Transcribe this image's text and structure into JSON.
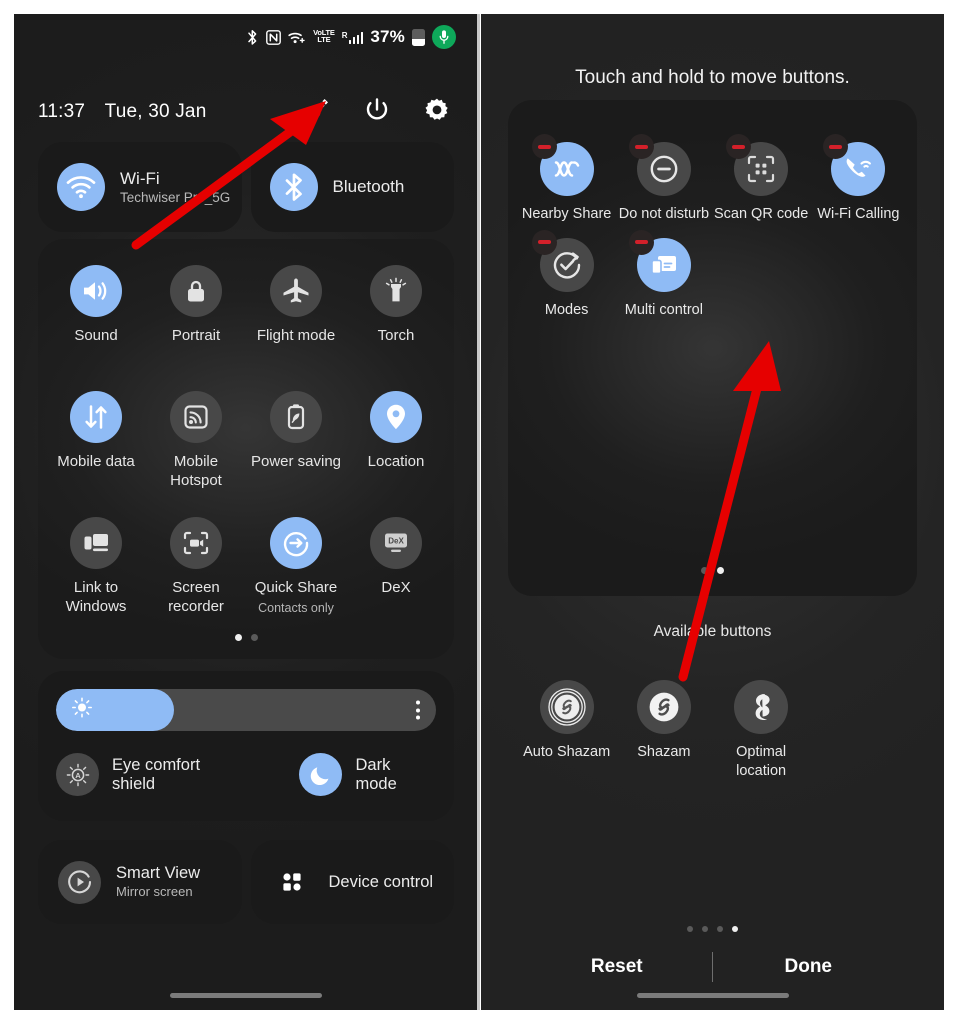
{
  "colors": {
    "accent_blue": "#8FBBF5",
    "tile_off": "#484848",
    "panel_bg": "#1c1c1c",
    "card_bg": "#1a1a1a",
    "badge_red": "#d4202a",
    "arrow_red": "#e60000",
    "mic_green": "#0ea85a"
  },
  "left_panel": {
    "status_bar": {
      "icons": [
        "bluetooth-icon",
        "nfc-icon",
        "wifi-icon",
        "volte-icon",
        "signal-roaming-icon"
      ],
      "volte_top": "VoLTE",
      "volte_bottom": "LTE",
      "roaming_letter": "R",
      "battery_percent": "37%",
      "mic_indicator": "microphone-icon"
    },
    "header": {
      "time": "11:37",
      "date": "Tue, 30 Jan",
      "actions": [
        {
          "name": "edit-pencil-button",
          "icon": "pencil-icon"
        },
        {
          "name": "power-button",
          "icon": "power-icon"
        },
        {
          "name": "settings-button",
          "icon": "gear-icon"
        }
      ]
    },
    "connectivity": [
      {
        "icon": "wifi-icon",
        "title": "Wi-Fi",
        "subtitle": "Techwiser Pro_5G",
        "active": true
      },
      {
        "icon": "bluetooth-icon",
        "title": "Bluetooth",
        "subtitle": "",
        "active": true
      }
    ],
    "tiles": [
      {
        "icon": "sound-icon",
        "label": "Sound",
        "sub": "",
        "active": true
      },
      {
        "icon": "portrait-lock-icon",
        "label": "Portrait",
        "sub": "",
        "active": false
      },
      {
        "icon": "airplane-icon",
        "label": "Flight mode",
        "sub": "",
        "active": false
      },
      {
        "icon": "torch-icon",
        "label": "Torch",
        "sub": "",
        "active": false
      },
      {
        "icon": "mobile-data-icon",
        "label": "Mobile data",
        "sub": "",
        "active": true
      },
      {
        "icon": "hotspot-icon",
        "label": "Mobile Hotspot",
        "sub": "",
        "active": false
      },
      {
        "icon": "power-saving-icon",
        "label": "Power saving",
        "sub": "",
        "active": false
      },
      {
        "icon": "location-pin-icon",
        "label": "Location",
        "sub": "",
        "active": true
      },
      {
        "icon": "link-to-windows-icon",
        "label": "Link to Windows",
        "sub": "",
        "active": false
      },
      {
        "icon": "screen-recorder-icon",
        "label": "Screen recorder",
        "sub": "",
        "active": false
      },
      {
        "icon": "quick-share-icon",
        "label": "Quick Share",
        "sub": "Contacts only",
        "active": true
      },
      {
        "icon": "dex-icon",
        "label": "DeX",
        "sub": "",
        "active": false
      }
    ],
    "tiles_pages": {
      "count": 2,
      "active": 0
    },
    "brightness": {
      "value_percent": 31,
      "slider_icon": "brightness-sun-icon",
      "menu_icon": "kebab-menu-icon",
      "toggles": [
        {
          "icon": "eye-comfort-icon",
          "label": "Eye comfort shield",
          "active": false
        },
        {
          "icon": "dark-mode-moon-icon",
          "label": "Dark mode",
          "active": true
        }
      ]
    },
    "bottom_cards": [
      {
        "icon": "smart-view-icon",
        "title": "Smart View",
        "subtitle": "Mirror screen"
      },
      {
        "icon": "device-control-icon",
        "title": "Device control",
        "subtitle": ""
      }
    ]
  },
  "right_panel": {
    "title": "Touch and hold to move buttons.",
    "active_tiles": [
      {
        "icon": "nearby-share-icon",
        "label": "Nearby Share",
        "active": true
      },
      {
        "icon": "do-not-disturb-icon",
        "label": "Do not disturb",
        "active": false
      },
      {
        "icon": "scan-qr-icon",
        "label": "Scan QR code",
        "active": false
      },
      {
        "icon": "wifi-calling-icon",
        "label": "Wi-Fi Calling",
        "active": true
      },
      {
        "icon": "modes-icon",
        "label": "Modes",
        "active": false
      },
      {
        "icon": "multi-control-icon",
        "label": "Multi control",
        "active": true
      }
    ],
    "active_pages": {
      "count": 2,
      "active": 1
    },
    "available_title": "Available buttons",
    "available_tiles": [
      {
        "icon": "auto-shazam-icon",
        "label": "Auto Shazam"
      },
      {
        "icon": "shazam-icon",
        "label": "Shazam"
      },
      {
        "icon": "optimal-location-icon",
        "label": "Optimal location"
      }
    ],
    "footer_pages": {
      "count": 4,
      "active": 3
    },
    "footer": {
      "reset_label": "Reset",
      "done_label": "Done"
    }
  },
  "annotations": [
    {
      "name": "arrow-to-edit-pencil",
      "target": "edit-pencil-button"
    },
    {
      "name": "arrow-to-multi-control",
      "target": "multi-control-tile"
    }
  ]
}
